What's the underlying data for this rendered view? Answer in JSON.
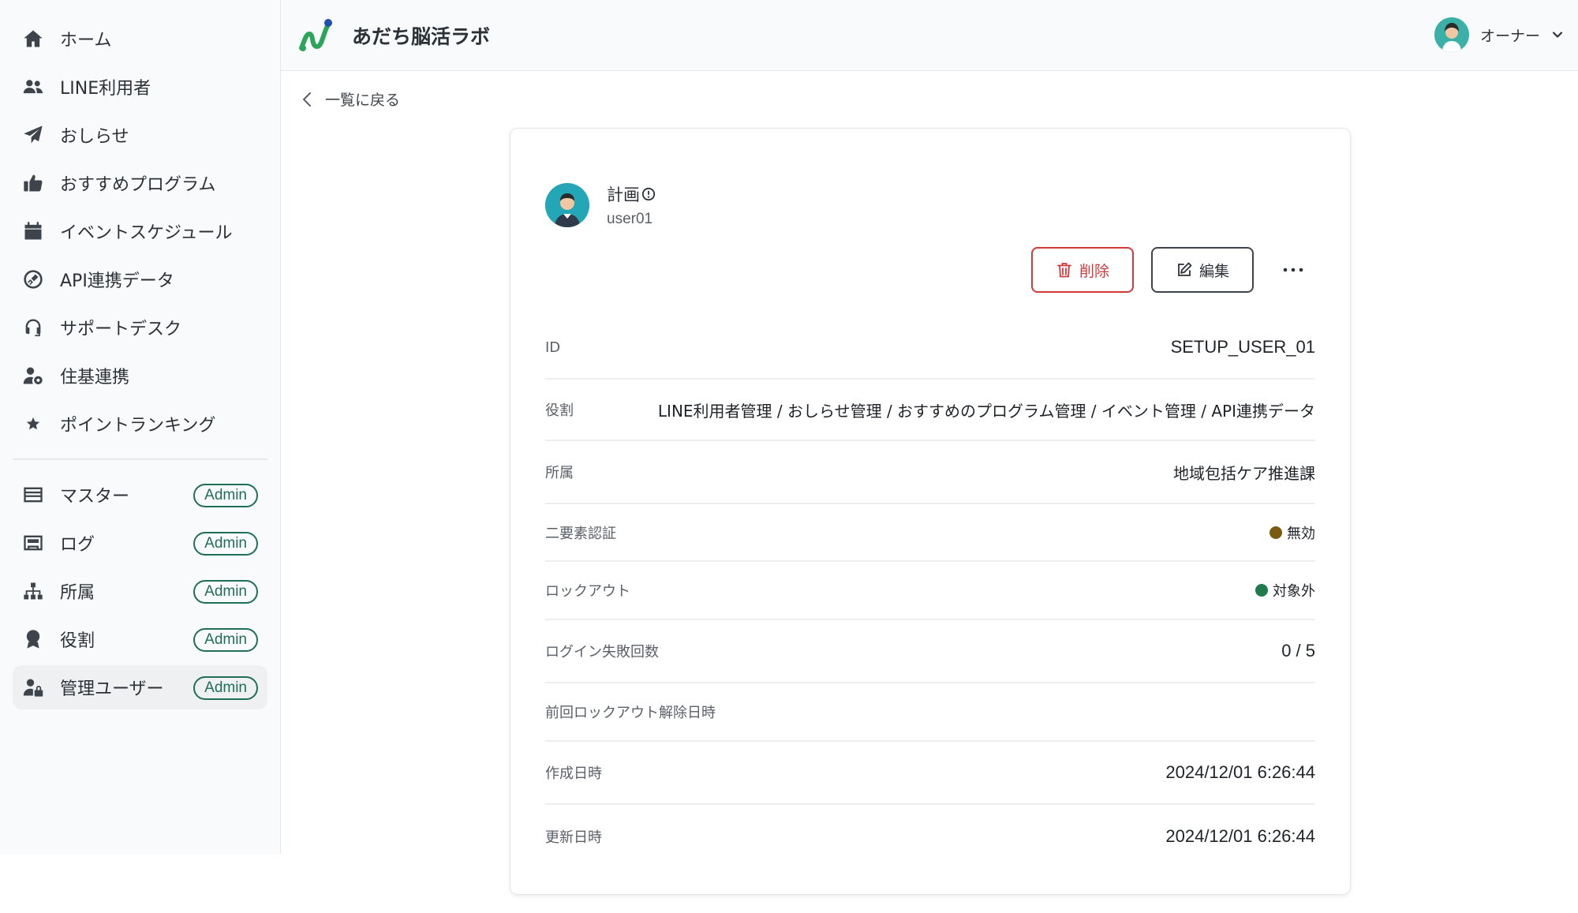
{
  "app": {
    "brand": "あだち脳活ラボ",
    "account_name": "オーナー"
  },
  "sidebar": {
    "items": [
      {
        "label": "ホーム",
        "icon": "home-icon"
      },
      {
        "label": "LINE利用者",
        "icon": "users-icon"
      },
      {
        "label": "おしらせ",
        "icon": "paper-plane-icon"
      },
      {
        "label": "おすすめプログラム",
        "icon": "thumbs-up-icon"
      },
      {
        "label": "イベントスケジュール",
        "icon": "calendar-icon"
      },
      {
        "label": "API連携データ",
        "icon": "plug-icon"
      },
      {
        "label": "サポートデスク",
        "icon": "headset-icon"
      },
      {
        "label": "住基連携",
        "icon": "user-gear-icon"
      },
      {
        "label": "ポイントランキング",
        "icon": "star-icon"
      }
    ],
    "admin_items": [
      {
        "label": "マスター",
        "icon": "list-icon",
        "badge": "Admin"
      },
      {
        "label": "ログ",
        "icon": "log-icon",
        "badge": "Admin"
      },
      {
        "label": "所属",
        "icon": "sitemap-icon",
        "badge": "Admin"
      },
      {
        "label": "役割",
        "icon": "award-icon",
        "badge": "Admin"
      },
      {
        "label": "管理ユーザー",
        "icon": "user-lock-icon",
        "badge": "Admin",
        "active": true
      }
    ]
  },
  "main": {
    "back_label": "一覧に戻る",
    "profile": {
      "name": "計画",
      "username": "user01"
    },
    "actions": {
      "delete_label": "削除",
      "edit_label": "編集",
      "more_label": "···"
    },
    "fields": [
      {
        "label": "ID",
        "value": "SETUP_USER_01"
      },
      {
        "label": "役割",
        "value": "LINE利用者管理 / おしらせ管理 / おすすめのプログラム管理 / イベント管理 / API連携データ"
      },
      {
        "label": "所属",
        "value": "地域包括ケア推進課"
      },
      {
        "label": "二要素認証",
        "value": "無効",
        "status_color": "#7a5a10"
      },
      {
        "label": "ロックアウト",
        "value": "対象外",
        "status_color": "#1f7a4c"
      },
      {
        "label": "ログイン失敗回数",
        "value": "0 / 5"
      },
      {
        "label": "前回ロックアウト解除日時",
        "value": ""
      },
      {
        "label": "作成日時",
        "value": "2024/12/01 6:26:44"
      },
      {
        "label": "更新日時",
        "value": "2024/12/01 6:26:44"
      }
    ]
  },
  "colors": {
    "accent": "#1f6e58",
    "danger": "#d03a3a"
  }
}
